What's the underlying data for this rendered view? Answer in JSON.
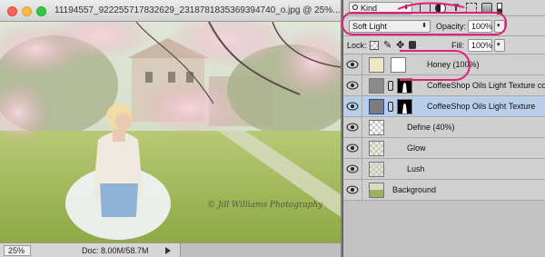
{
  "window": {
    "title": "11194557_922255717832629_2318781835369394740_o.jpg @ 25%..."
  },
  "canvas": {
    "watermark": "© Jill Williams Photography"
  },
  "statusbar": {
    "zoom": "25%",
    "doc_info": "Doc: 8.00M/58.7M"
  },
  "panel": {
    "filter_kind": "Kind",
    "blend_mode": "Soft Light",
    "opacity_label": "Opacity:",
    "opacity_value": "100%",
    "lock_label": "Lock:",
    "fill_label": "Fill:",
    "fill_value": "100%",
    "layers": [
      {
        "name": "Honey (100%)"
      },
      {
        "name": "CoffeeShop Oils Light Texture copy"
      },
      {
        "name": "CoffeeShop Oils Light Texture"
      },
      {
        "name": "Define (40%)"
      },
      {
        "name": "Glow"
      },
      {
        "name": "Lush"
      },
      {
        "name": "Background"
      }
    ]
  },
  "colors": {
    "annotation": "#e0207a",
    "selected_layer": "#b9cfe9",
    "honey_swatch": "#f1e6c4"
  }
}
